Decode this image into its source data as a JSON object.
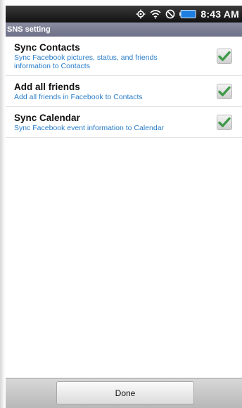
{
  "status_bar": {
    "time": "8:43 AM",
    "icons": [
      "gps-icon",
      "wifi-icon",
      "no-signal-icon",
      "battery-icon"
    ]
  },
  "title_bar": {
    "title": "SNS setting"
  },
  "settings": [
    {
      "title": "Sync Contacts",
      "subtitle_lines": [
        "Sync Facebook pictures, status, and friends",
        "information to Contacts"
      ],
      "checked": true
    },
    {
      "title": "Add all friends",
      "subtitle_lines": [
        "Add all friends in Facebook to Contacts"
      ],
      "checked": true
    },
    {
      "title": "Sync Calendar",
      "subtitle_lines": [
        "Sync Facebook event information to Calendar"
      ],
      "checked": true
    }
  ],
  "bottom_bar": {
    "done_label": "Done"
  },
  "colors": {
    "status_bar": "#111111",
    "title_bar": "#7a7d92",
    "subtitle_text": "#2a7dc9",
    "check_green": "#3f9a4a",
    "battery_fill": "#1f7fe0"
  }
}
